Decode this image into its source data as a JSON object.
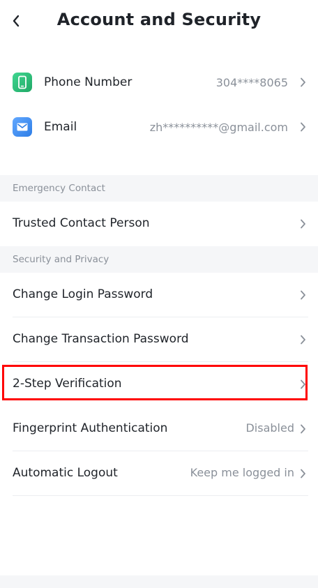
{
  "header": {
    "title": "Account and Security"
  },
  "contacts": {
    "phone": {
      "label": "Phone Number",
      "value": "304****8065"
    },
    "email": {
      "label": "Email",
      "value": "zh**********@gmail.com"
    }
  },
  "sections": {
    "emergency": {
      "title": "Emergency Contact",
      "items": [
        {
          "label": "Trusted Contact Person",
          "value": ""
        }
      ]
    },
    "security": {
      "title": "Security and Privacy",
      "items": [
        {
          "label": "Change Login Password",
          "value": ""
        },
        {
          "label": "Change Transaction Password",
          "value": ""
        },
        {
          "label": "2-Step Verification",
          "value": ""
        },
        {
          "label": "Fingerprint Authentication",
          "value": "Disabled"
        },
        {
          "label": "Automatic Logout",
          "value": "Keep me logged in"
        }
      ]
    }
  },
  "colors": {
    "phone_icon": "#2ec27e",
    "email_icon": "#3b8bf0",
    "highlight_box": "#ff0000",
    "section_background": "#f5f6f8"
  }
}
